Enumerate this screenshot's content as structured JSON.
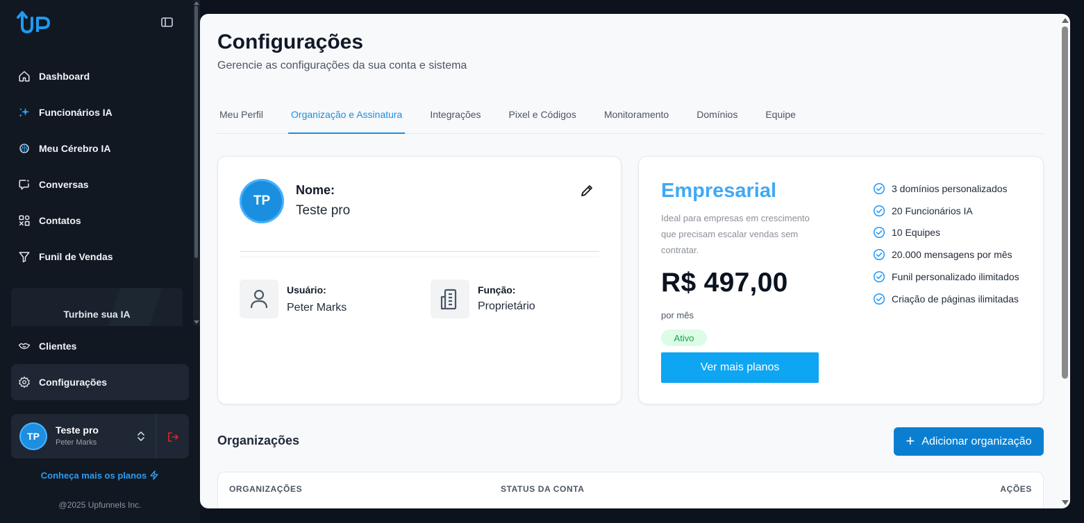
{
  "sidebar": {
    "logo_text": "UP",
    "nav": [
      {
        "label": "Dashboard",
        "icon": "home-icon"
      },
      {
        "label": "Funcionários IA",
        "icon": "sparkles-icon"
      },
      {
        "label": "Meu Cérebro IA",
        "icon": "brain-icon"
      },
      {
        "label": "Conversas",
        "icon": "chat-icon"
      },
      {
        "label": "Contatos",
        "icon": "contacts-icon"
      },
      {
        "label": "Funil de Vendas",
        "icon": "funnel-icon"
      }
    ],
    "promo_label": "Turbine sua IA",
    "nav2": [
      {
        "label": "Clientes",
        "icon": "handshake-icon"
      },
      {
        "label": "Configurações",
        "icon": "gear-icon",
        "active": true
      }
    ],
    "user": {
      "initials": "TP",
      "name": "Teste pro",
      "subtitle": "Peter Marks"
    },
    "plans_link": "Conheça mais os planos",
    "copyright": "@2025 Upfunnels Inc."
  },
  "header": {
    "title": "Configurações",
    "subtitle": "Gerencie as configurações da sua conta e sistema"
  },
  "tabs": [
    {
      "label": "Meu Perfil",
      "active": false
    },
    {
      "label": "Organização e Assinatura",
      "active": true
    },
    {
      "label": "Integrações",
      "active": false
    },
    {
      "label": "Pixel e Códigos",
      "active": false
    },
    {
      "label": "Monitoramento",
      "active": false
    },
    {
      "label": "Domínios",
      "active": false
    },
    {
      "label": "Equipe",
      "active": false
    }
  ],
  "profile": {
    "initials": "TP",
    "name_label": "Nome:",
    "name_value": "Teste pro",
    "user_label": "Usuário:",
    "user_value": "Peter Marks",
    "role_label": "Função:",
    "role_value": "Proprietário"
  },
  "plan": {
    "name": "Empresarial",
    "description": "Ideal para empresas em crescimento que precisam escalar vendas sem contratar.",
    "price": "R$ 497,00",
    "period": "por mês",
    "status": "Ativo",
    "button_label": "Ver mais planos",
    "features": [
      "3 domínios personalizados",
      "20 Funcionários IA",
      "10 Equipes",
      "20.000 mensagens por mês",
      "Funil personalizado ilimitados",
      "Criação de páginas ilimitadas"
    ]
  },
  "organizations": {
    "title": "Organizações",
    "add_button": "Adicionar organização",
    "columns": [
      "ORGANIZAÇÕES",
      "STATUS DA CONTA",
      "AÇÕES"
    ]
  },
  "colors": {
    "accent": "#1a8fe0",
    "plan_name": "#3fa9f5",
    "primary_button": "#0ea5f3",
    "add_button": "#0a7fd2",
    "status_active_bg": "#dcfce7",
    "status_active_text": "#16a34a",
    "logout": "#dc2626"
  }
}
